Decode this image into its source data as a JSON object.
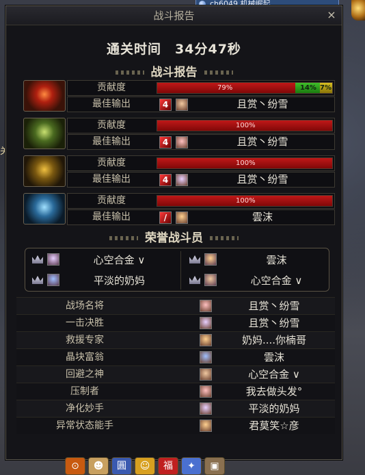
{
  "window": {
    "title": "战斗报告",
    "close": "×"
  },
  "top_strip": "ch6049 机械崛起",
  "side_text": "关会",
  "clear_time": "通关时间　34分47秒",
  "report_title": "战斗报告",
  "honor_title": "荣誉战斗员",
  "contribution_label": "贡献度",
  "best_output_label": "最佳输出",
  "reports": [
    {
      "boss_icon": "flame-demon-icon",
      "bars": [
        {
          "pct": 0.79,
          "label": "79%"
        },
        {
          "pct": 0.14,
          "label": "14%"
        },
        {
          "pct": 0.07,
          "label": "7%"
        }
      ],
      "skill": "4",
      "player": "且赏丶纷雪"
    },
    {
      "boss_icon": "green-claw-demon-icon",
      "bars": [
        {
          "pct": 1.0,
          "label": "100%"
        }
      ],
      "skill": "4",
      "player": "且赏丶纷雪"
    },
    {
      "boss_icon": "gold-claw-demon-icon",
      "bars": [
        {
          "pct": 1.0,
          "label": "100%"
        }
      ],
      "skill": "4",
      "player": "且赏丶纷雪"
    },
    {
      "boss_icon": "ice-claw-demon-icon",
      "bars": [
        {
          "pct": 1.0,
          "label": "100%"
        }
      ],
      "skill": "/",
      "player": "雲沫"
    }
  ],
  "honor": [
    {
      "name": "心空合金 ∨"
    },
    {
      "name": "雲沫"
    },
    {
      "name": "平淡的奶妈"
    },
    {
      "name": "心空合金 ∨"
    }
  ],
  "awards": [
    {
      "title": "战场名将",
      "player": "且赏丶纷雪"
    },
    {
      "title": "一击决胜",
      "player": "且赏丶纷雪"
    },
    {
      "title": "救援专家",
      "player": "奶妈....你楠哥"
    },
    {
      "title": "晶块富翁",
      "player": "雲沫"
    },
    {
      "title": "回避之神",
      "player": "心空合金 ∨"
    },
    {
      "title": "压制者",
      "player": "我去做头发°"
    },
    {
      "title": "净化妙手",
      "player": "平淡的奶妈"
    },
    {
      "title": "异常状态能手",
      "player": "君莫笑☆彦"
    }
  ],
  "taskbar": [
    "⊙",
    "☻",
    "圓",
    "☺",
    "福",
    "✦",
    "▣"
  ],
  "colors": {
    "bar_red": "#c01818",
    "bar_green": "#3fbf2a",
    "bar_yellow": "#d8c020",
    "accent_text": "#e0d8c2"
  }
}
